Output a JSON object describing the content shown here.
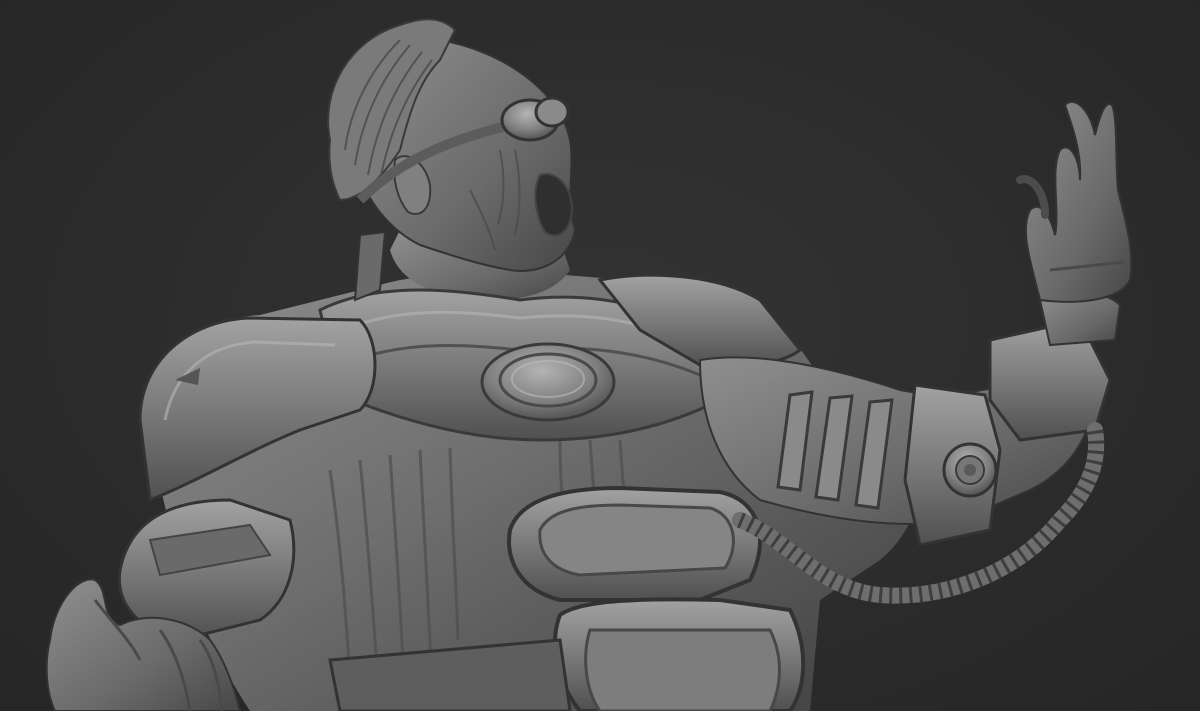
{
  "scene": {
    "subject": "sculpt-render",
    "background_color": "#2b2b2b",
    "material": {
      "base": "#6b6b6b",
      "highlight": "#a9a9a9",
      "mid": "#7d7d7d",
      "shadow": "#3c3c3c",
      "deep_shadow": "#262626"
    }
  }
}
